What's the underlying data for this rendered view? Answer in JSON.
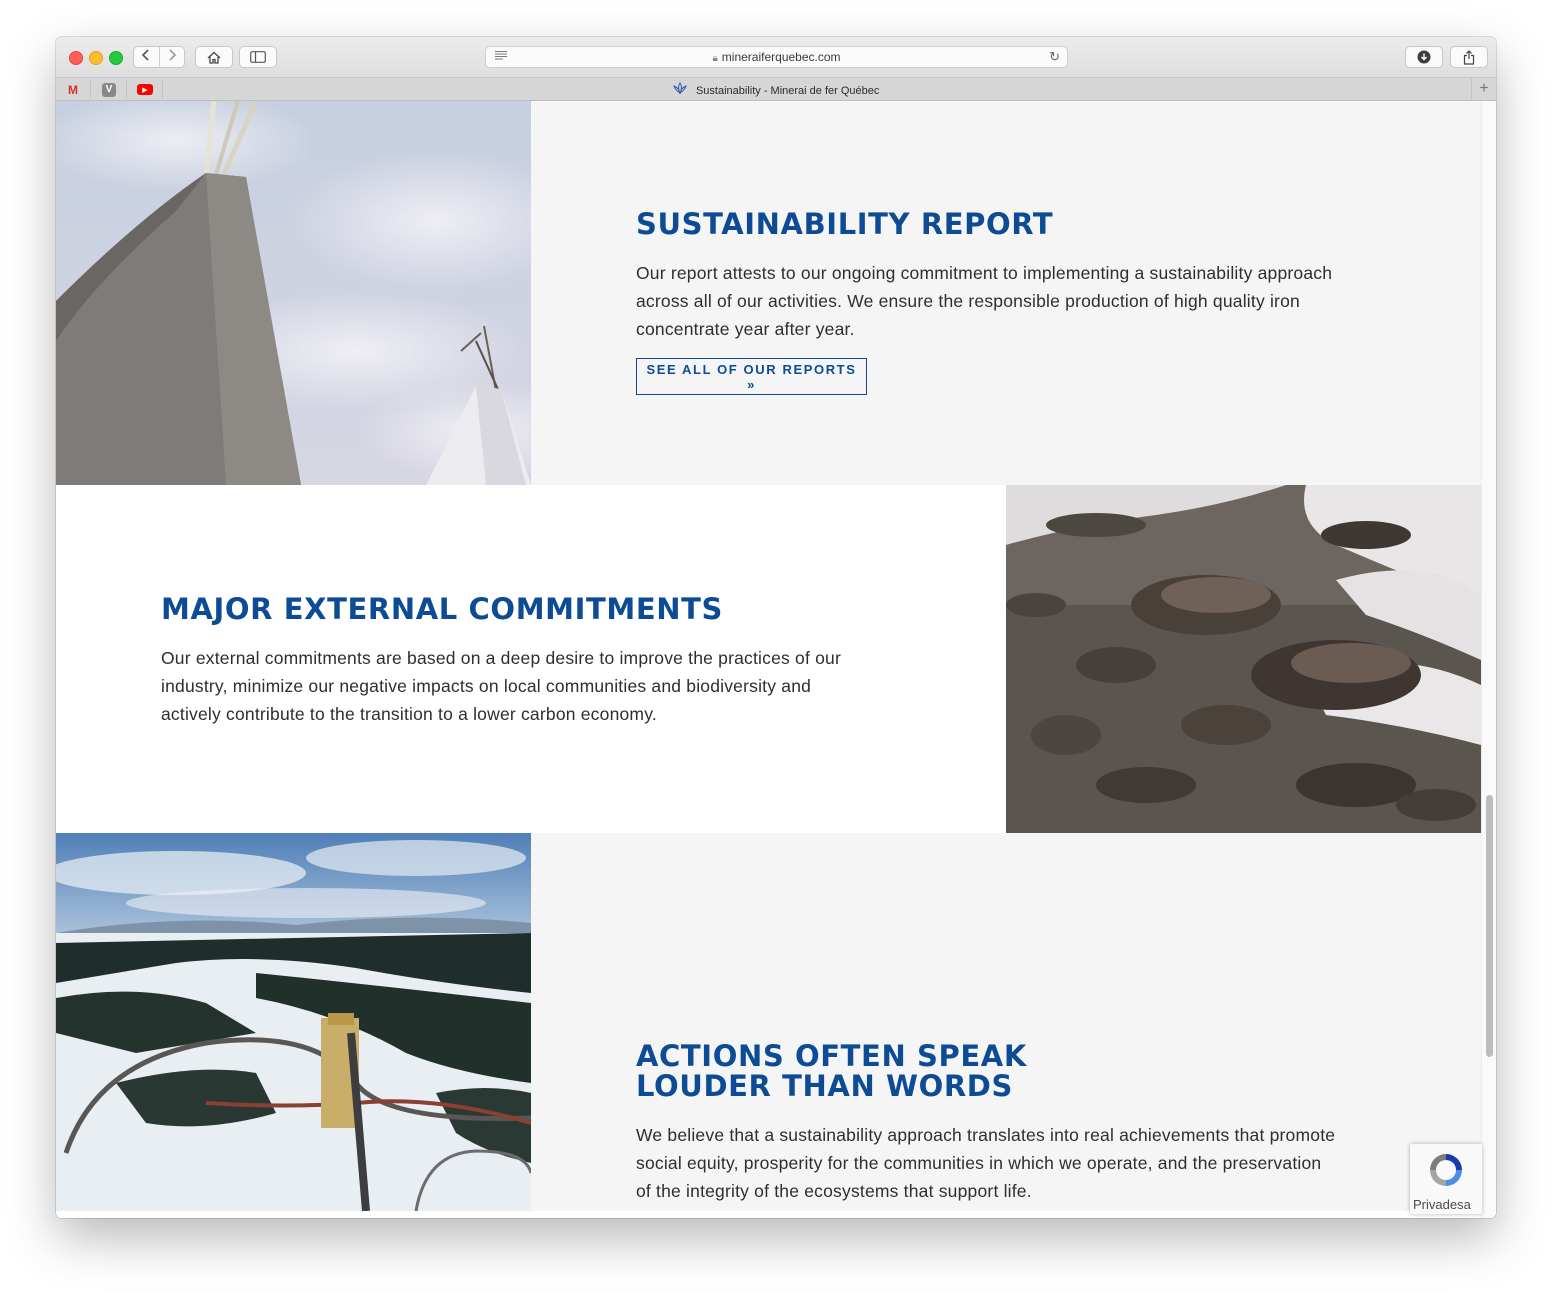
{
  "browser": {
    "url": "mineraiferquebec.com",
    "tab_title": "Sustainability - Minerai de fer Québec",
    "favorites": [
      "M",
      "V",
      "▶"
    ],
    "new_tab_label": "+"
  },
  "sections": [
    {
      "heading": "SUSTAINABILITY REPORT",
      "body": "Our report attests to our ongoing commitment to implementing a sustainability approach across all of our activities. We ensure the responsible production of high quality iron concentrate year after year.",
      "button_label": "SEE ALL OF OUR REPORTS »"
    },
    {
      "heading": "MAJOR EXTERNAL COMMITMENTS",
      "body": "Our external commitments are based on a deep desire to improve the practices of our industry, minimize our negative impacts on local communities and biodiversity and actively contribute to the transition to a lower carbon economy."
    },
    {
      "heading_line1": "ACTIONS OFTEN SPEAK",
      "heading_line2": "LOUDER THAN WORDS",
      "body": "We believe that a sustainability approach translates into real achievements that promote social equity, prosperity for the communities in which we operate, and the preservation of the integrity of the ecosystems that support life."
    }
  ],
  "recaptcha": {
    "label": "Privadesa"
  },
  "icons": {
    "back": "chevron-left-icon",
    "forward": "chevron-right-icon",
    "home": "home-icon",
    "sidebar": "sidebar-icon",
    "download": "download-icon",
    "share": "share-icon",
    "lock": "lock-icon",
    "reload": "reload-icon"
  },
  "colors": {
    "heading": "#0d4c94",
    "section_alt_bg": "#f5f5f6"
  }
}
